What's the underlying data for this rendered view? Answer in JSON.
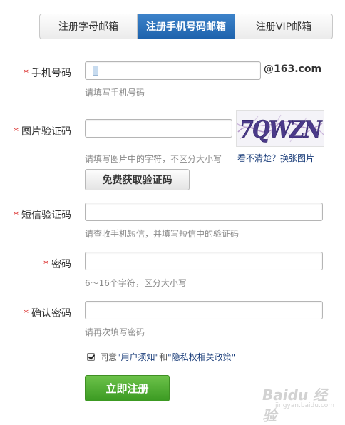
{
  "tabs": [
    {
      "label": "注册字母邮箱",
      "active": false
    },
    {
      "label": "注册手机号码邮箱",
      "active": true
    },
    {
      "label": "注册VIP邮箱",
      "active": false
    }
  ],
  "form": {
    "required_mark": "*",
    "phone": {
      "label": "手机号码",
      "value": "",
      "suffix": "@163.com",
      "hint": "请填写手机号码"
    },
    "captcha": {
      "label": "图片验证码",
      "value": "",
      "hint": "请填写图片中的字符，不区分大小写",
      "image_text": "7QWZN",
      "unclear_text": "看不清楚？换张图片"
    },
    "get_code_button": "免费获取验证码",
    "sms": {
      "label": "短信验证码",
      "value": "",
      "hint": "请查收手机短信，并填写短信中的验证码"
    },
    "password": {
      "label": "密码",
      "value": "",
      "hint": "6～16个字符，区分大小写"
    },
    "confirm": {
      "label": "确认密码",
      "value": "",
      "hint": "请再次填写密码"
    },
    "agreement": {
      "checked": true,
      "prefix": "同意",
      "link1": "\"用户须知\"",
      "conj": "和",
      "link2": "\"隐私权相关政策\""
    },
    "submit_button": "立即注册"
  },
  "watermark": {
    "main": "Baidu 经验",
    "sub": "jingyan.baidu.com"
  },
  "colors": {
    "accent_blue": "#2a6fb8",
    "required_red": "#d9211e",
    "submit_green": "#4faa30",
    "hint_gray": "#8a8a8a",
    "link_blue": "#1a3d7a"
  }
}
